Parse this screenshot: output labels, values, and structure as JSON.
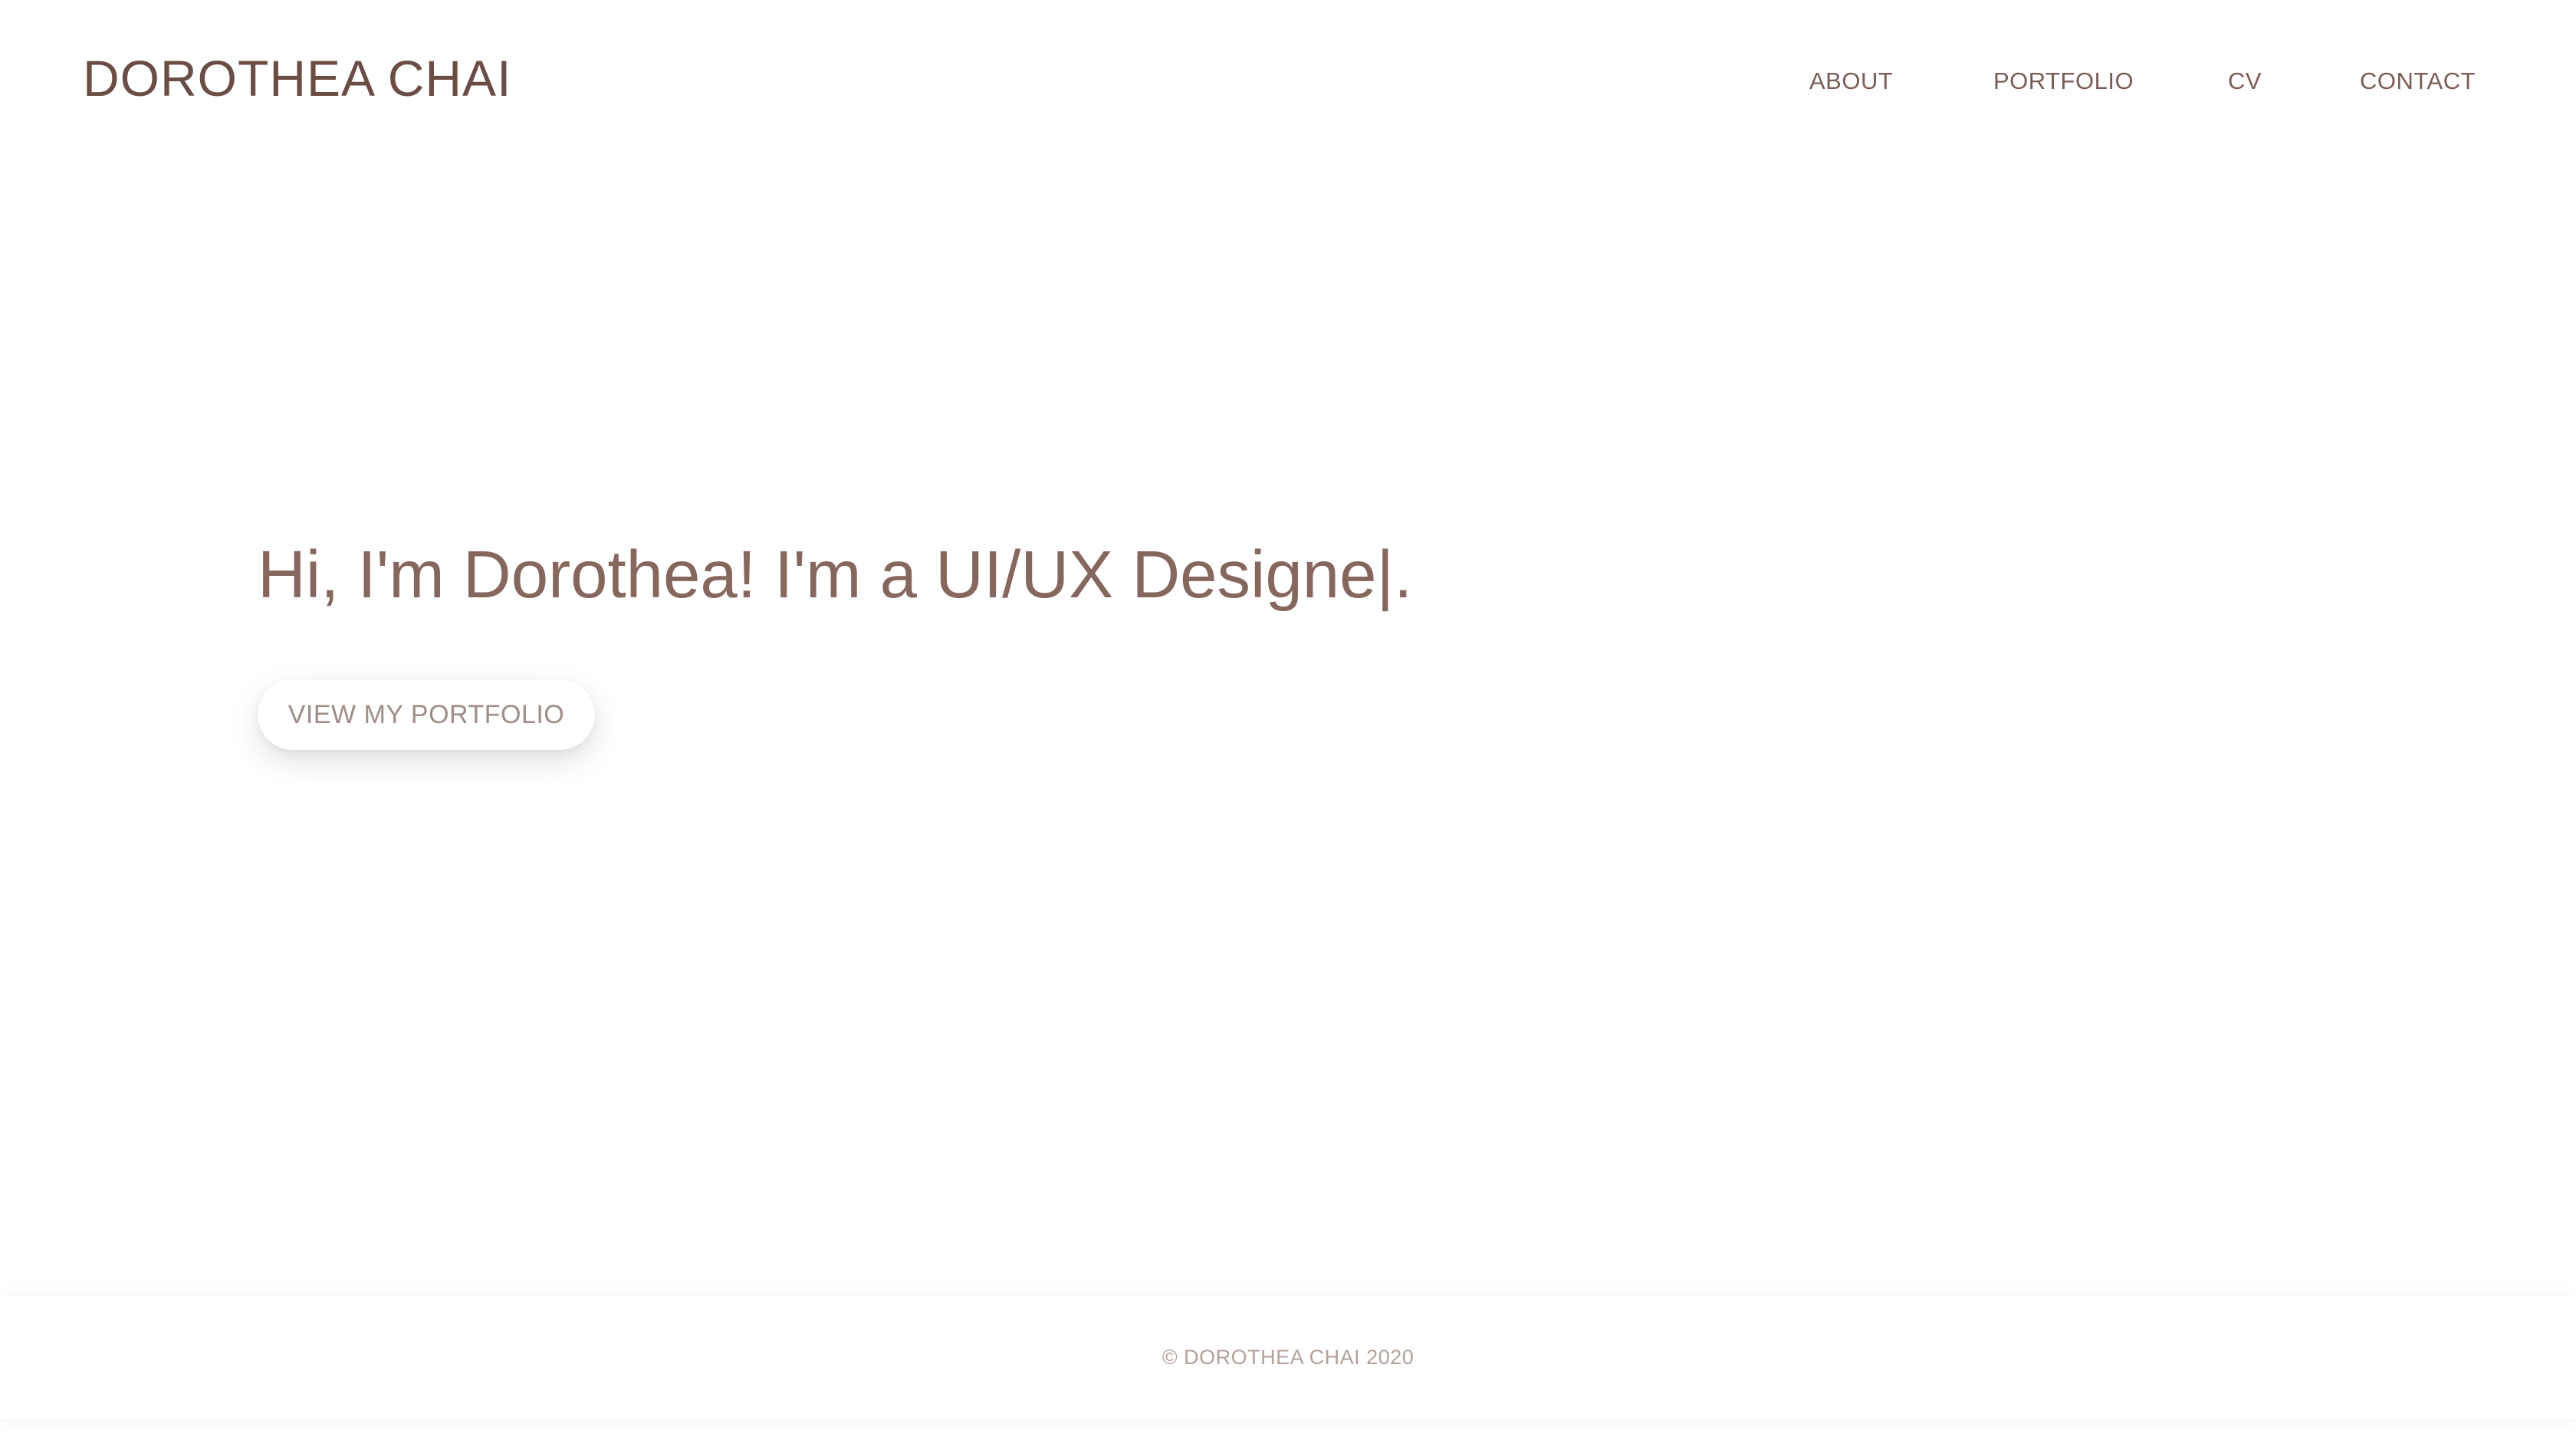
{
  "header": {
    "logo": "DOROTHEA CHAI",
    "nav": {
      "about": "ABOUT",
      "portfolio": "PORTFOLIO",
      "cv": "CV",
      "contact": "CONTACT"
    }
  },
  "hero": {
    "title": "Hi, I'm Dorothea! I'm a UI/UX Designe|.",
    "cta_label": "VIEW MY PORTFOLIO"
  },
  "footer": {
    "copyright": "© DOROTHEA CHAI 2020"
  },
  "colors": {
    "brand_text": "#6a4d45",
    "hero_text": "#86675e",
    "button_text": "#a08d88",
    "footer_text": "#b3a19c",
    "background": "#ffffff"
  }
}
